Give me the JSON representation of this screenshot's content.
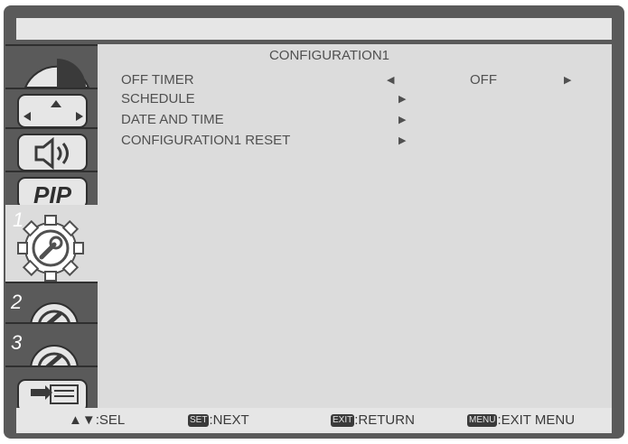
{
  "menu": {
    "title": "CONFIGURATION1",
    "items": [
      {
        "label": "OFF TIMER",
        "left_arrow": "◀",
        "value": "OFF",
        "right_arrow": "▶"
      },
      {
        "label": "SCHEDULE",
        "right_arrow": "▶"
      },
      {
        "label": "DATE AND TIME",
        "right_arrow": "▶"
      },
      {
        "label": "CONFIGURATION1 RESET",
        "right_arrow": "▶"
      }
    ]
  },
  "sidebar": {
    "tabs": [
      {
        "icon": "picture-icon"
      },
      {
        "icon": "screen-icon"
      },
      {
        "icon": "audio-icon"
      },
      {
        "icon": "pip-icon",
        "label": "PIP"
      },
      {
        "icon": "configuration1-icon",
        "number": "1",
        "active": true
      },
      {
        "icon": "configuration2-icon",
        "number": "2"
      },
      {
        "icon": "configuration3-icon",
        "number": "3"
      },
      {
        "icon": "advanced-option-icon"
      }
    ]
  },
  "footer": {
    "sel": {
      "keys": "▲▼",
      "label": ":SEL"
    },
    "next": {
      "key": "SET",
      "label": ":NEXT"
    },
    "return": {
      "key": "EXIT",
      "label": ":RETURN"
    },
    "exit_menu": {
      "key": "MENU",
      "label": ":EXIT MENU"
    }
  }
}
